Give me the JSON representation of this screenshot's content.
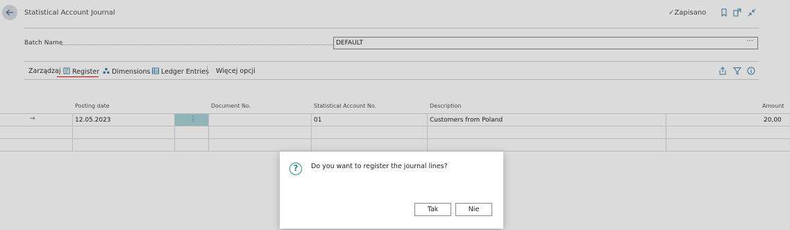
{
  "header": {
    "title": "Statistical Account Journal",
    "saved_label": "Zapisano"
  },
  "batch": {
    "label": "Batch Name",
    "value": "DEFAULT",
    "more": "···"
  },
  "actions": {
    "manage": "Zarządzaj",
    "register": "Register",
    "dimensions": "Dimensions",
    "ledger_entries": "Ledger Entries",
    "more_options": "Więcej opcji"
  },
  "table": {
    "columns": [
      "Posting date",
      "Document No.",
      "Statistical Account No.",
      "Description",
      "Amount"
    ],
    "rows": [
      {
        "posting_date": "12.05.2023",
        "document_no": "",
        "account_no": "01",
        "description": "Customers from Poland",
        "amount": "20,00"
      }
    ]
  },
  "dialog": {
    "question": "Do you want to register the journal lines?",
    "yes": "Tak",
    "no": "Nie"
  },
  "colors": {
    "accent": "#2a8d8d",
    "underline": "#e00000",
    "selected_cell": "#a9d2d8"
  }
}
